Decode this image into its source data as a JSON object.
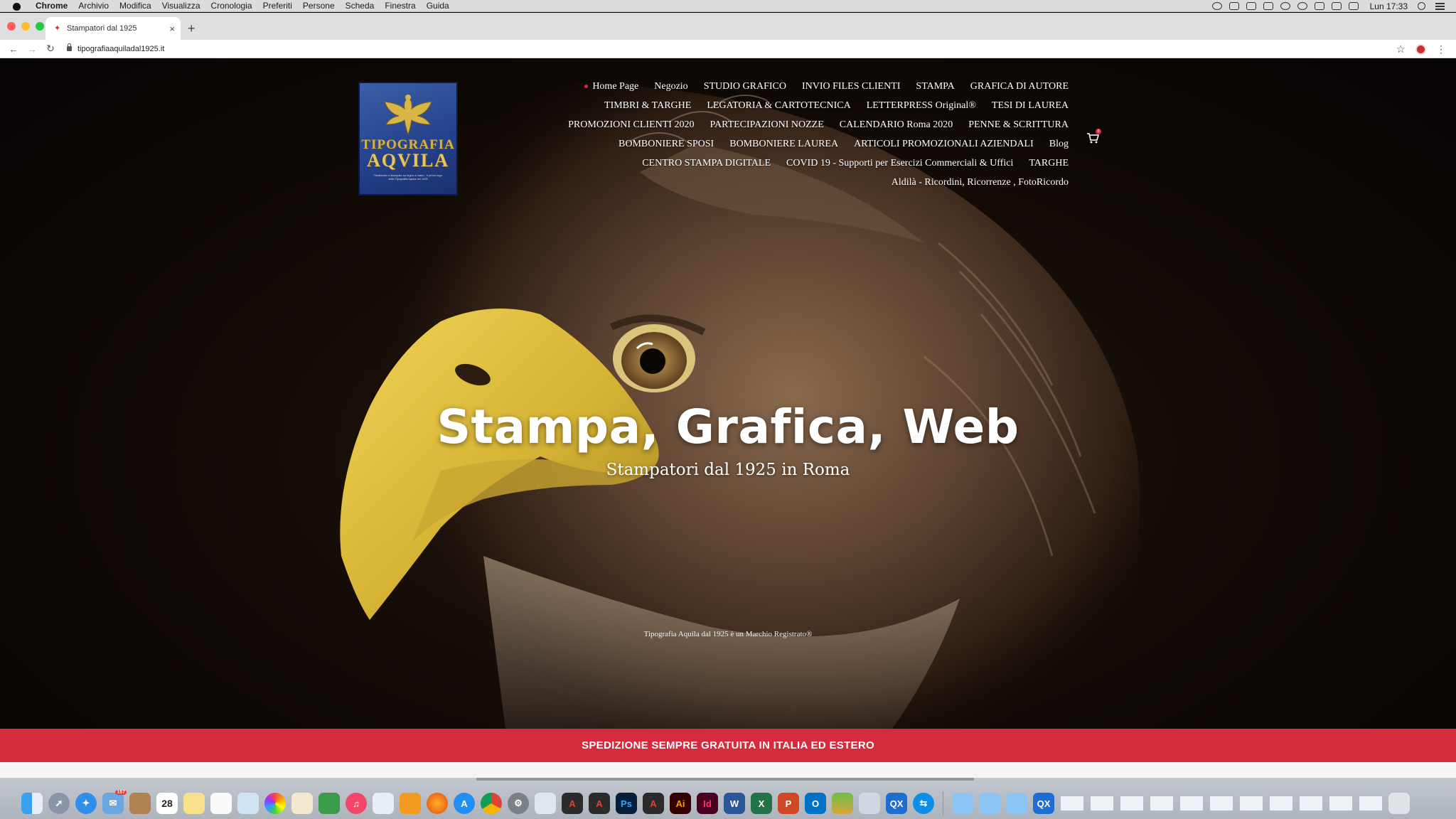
{
  "menubar": {
    "app_name": "Chrome",
    "menus": [
      "Archivio",
      "Modifica",
      "Visualizza",
      "Cronologia",
      "Preferiti",
      "Persone",
      "Scheda",
      "Finestra",
      "Guida"
    ],
    "clock": "Lun 17:33"
  },
  "browser": {
    "tab_title": "Stampatori dal 1925",
    "url": "tipografiaaquiladal1925.it"
  },
  "site": {
    "logo": {
      "line1": "TIPOGRAFIA",
      "line2": "AQVILA",
      "tagline": "Realizzato e stampato su legno a mano - Il primo logo della Tipografia Aquila nel 1925"
    },
    "nav_rows": [
      [
        "Home Page",
        "Negozio",
        "STUDIO GRAFICO",
        "INVIO FILES CLIENTI",
        "STAMPA",
        "GRAFICA DI AUTORE"
      ],
      [
        "TIMBRI & TARGHE",
        "LEGATORIA & CARTOTECNICA",
        "LETTERPRESS Original®",
        "TESI DI LAUREA"
      ],
      [
        "PROMOZIONI CLIENTI 2020",
        "PARTECIPAZIONI NOZZE",
        "CALENDARIO Roma 2020",
        "PENNE & SCRITTURA"
      ],
      [
        "BOMBONIERE SPOSI",
        "BOMBONIERE LAUREA",
        "ARTICOLI PROMOZIONALI AZIENDALI",
        "Blog"
      ],
      [
        "CENTRO STAMPA DIGITALE",
        "COVID 19 - Supporti per Esercizi Commerciali & Uffici",
        "TARGHE"
      ],
      [
        "Aldilà - Ricordini, Ricorrenze , FotoRicordo"
      ]
    ],
    "cart_count": "0",
    "hero_title": "Stampa, Grafica, Web",
    "hero_subtitle": "Stampatori dal 1925 in Roma",
    "trademark_note": "Tipografia Aquila dal 1925  è un Marchio Registrato®",
    "shipping_banner": "SPEDIZIONE SEMPRE GRATUITA IN ITALIA ED ESTERO",
    "accent_color": "#d62b3c"
  },
  "dock": {
    "calendar_day": "28",
    "app_badge": "157",
    "apps": [
      "Finder",
      "Launchpad",
      "Safari",
      "Mail",
      "Contacts",
      "Calendar",
      "Notes",
      "Reminders",
      "Preview",
      "Photos",
      "TextEdit",
      "Numbers",
      "Music",
      "Pages-app",
      "iBooks",
      "Firefox",
      "App Store",
      "Chrome",
      "System Preferences",
      "Printer",
      "Acrobat",
      "Acrobat Reader",
      "Photoshop",
      "Acrobat DC",
      "Illustrator",
      "InDesign",
      "Word",
      "Excel",
      "PowerPoint",
      "Outlook",
      "Stacks",
      "Files",
      "QuarkXPress",
      "TeamViewer"
    ],
    "labels": {
      "photoshop": "Ps",
      "illustrator": "Ai",
      "indesign": "Id",
      "word": "W",
      "excel": "X",
      "powerpoint": "P",
      "outlook": "O",
      "quark": "QX"
    }
  }
}
